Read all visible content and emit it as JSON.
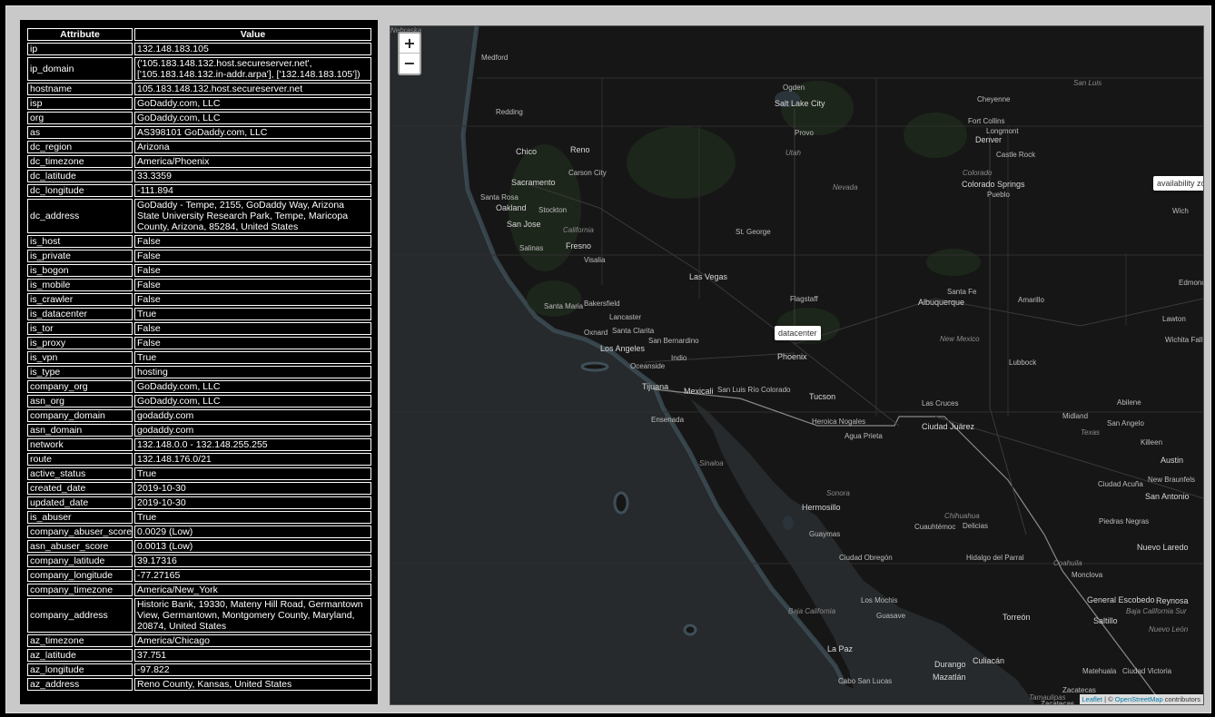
{
  "table": {
    "headers": [
      "Attribute",
      "Value"
    ],
    "rows": [
      [
        "ip",
        "132.148.183.105"
      ],
      [
        "ip_domain",
        "('105.183.148.132.host.secureserver.net', ['105.183.148.132.in-addr.arpa'], ['132.148.183.105'])"
      ],
      [
        "hostname",
        "105.183.148.132.host.secureserver.net"
      ],
      [
        "isp",
        "GoDaddy.com, LLC"
      ],
      [
        "org",
        "GoDaddy.com, LLC"
      ],
      [
        "as",
        "AS398101 GoDaddy.com, LLC"
      ],
      [
        "dc_region",
        "Arizona"
      ],
      [
        "dc_timezone",
        "America/Phoenix"
      ],
      [
        "dc_latitude",
        "33.3359"
      ],
      [
        "dc_longitude",
        "-111.894"
      ],
      [
        "dc_address",
        "GoDaddy - Tempe, 2155, GoDaddy Way, Arizona State University Research Park, Tempe, Maricopa County, Arizona, 85284, United States"
      ],
      [
        "is_host",
        "False"
      ],
      [
        "is_private",
        "False"
      ],
      [
        "is_bogon",
        "False"
      ],
      [
        "is_mobile",
        "False"
      ],
      [
        "is_crawler",
        "False"
      ],
      [
        "is_datacenter",
        "True"
      ],
      [
        "is_tor",
        "False"
      ],
      [
        "is_proxy",
        "False"
      ],
      [
        "is_vpn",
        "True"
      ],
      [
        "is_type",
        "hosting"
      ],
      [
        "company_org",
        "GoDaddy.com, LLC"
      ],
      [
        "asn_org",
        "GoDaddy.com, LLC"
      ],
      [
        "company_domain",
        "godaddy.com"
      ],
      [
        "asn_domain",
        "godaddy.com"
      ],
      [
        "network",
        "132.148.0.0 - 132.148.255.255"
      ],
      [
        "route",
        "132.148.176.0/21"
      ],
      [
        "active_status",
        "True"
      ],
      [
        "created_date",
        "2019-10-30"
      ],
      [
        "updated_date",
        "2019-10-30"
      ],
      [
        "is_abuser",
        "True"
      ],
      [
        "company_abuser_score",
        "0.0029 (Low)"
      ],
      [
        "asn_abuser_score",
        "0.0013 (Low)"
      ],
      [
        "company_latitude",
        "39.17316"
      ],
      [
        "company_longitude",
        "-77.27165"
      ],
      [
        "company_timezone",
        "America/New_York"
      ],
      [
        "company_address",
        "Historic Bank, 19330, Mateny Hill Road, Germantown View, Germantown, Montgomery County, Maryland, 20874, United States"
      ],
      [
        "az_timezone",
        "America/Chicago"
      ],
      [
        "az_latitude",
        "37.751"
      ],
      [
        "az_longitude",
        "-97.822"
      ],
      [
        "az_address",
        "Reno County, Kansas, United States"
      ]
    ]
  },
  "map": {
    "zoom_in": "+",
    "zoom_out": "−",
    "tooltips": {
      "datacenter": "datacenter",
      "availability_zone": "availability zo"
    },
    "attribution": {
      "leaflet": "Leaflet",
      "sep": " | © ",
      "osm": "OpenStreetMap",
      "tail": " contributors"
    },
    "cities": [
      "Medford",
      "Ogden",
      "Salt Lake City",
      "Cheyenne",
      "Redding",
      "Provo",
      "Fort Collins",
      "Longmont",
      "Denver",
      "Chico",
      "Reno",
      "Castle Rock",
      "Carson City",
      "Sacramento",
      "Colorado Springs",
      "Pueblo",
      "Santa Rosa",
      "Oakland",
      "Stockton",
      "San Jose",
      "St. George",
      "Fresno",
      "Salinas",
      "Visalia",
      "Las Vegas",
      "Santa Fe",
      "Amarillo",
      "Santa Maria",
      "Bakersfield",
      "Flagstaff",
      "Albuquerque",
      "Lancaster",
      "Oxnard",
      "Santa Clarita",
      "San Bernardino",
      "Los Angeles",
      "Phoenix",
      "Indio",
      "Oceanside",
      "Lubbock",
      "Tijuana",
      "Mexicali",
      "San Luis Río Colorado",
      "Tucson",
      "Las Cruces",
      "Ensenada",
      "Heroica Nogales",
      "Agua Prieta",
      "Ciudad Juárez",
      "Midland",
      "San Angelo",
      "Abilene",
      "Killeen",
      "Austin",
      "New Braunfels",
      "Ciudad Acuña",
      "San Antonio",
      "Piedras Negras",
      "Hermosillo",
      "Guaymas",
      "Cuauhtémoc",
      "Delicias",
      "Nuevo Laredo",
      "Ciudad Obregón",
      "Hidalgo del Parral",
      "Monclova",
      "General Escobedo",
      "Reynosa",
      "Los Mochis",
      "Guasave",
      "Torreón",
      "Saltillo",
      "La Paz",
      "Culiacán",
      "Durango",
      "Cabo San Lucas",
      "Mazatlán",
      "Zacatecas",
      "Matehuala",
      "Ciudad Victoria",
      "Edmond",
      "Lawton",
      "Wichita Falls",
      "Wich",
      "Colorado",
      "Nevada",
      "California",
      "Utah",
      "New Mexico",
      "Texas",
      "Sonora",
      "Chihuahua",
      "Coahuila",
      "Sinaloa",
      "Baja California",
      "Baja California Sur",
      "Nuevo León",
      "Tamaulipas",
      "Zacatecas",
      "San Luis",
      "Nebraska"
    ]
  }
}
